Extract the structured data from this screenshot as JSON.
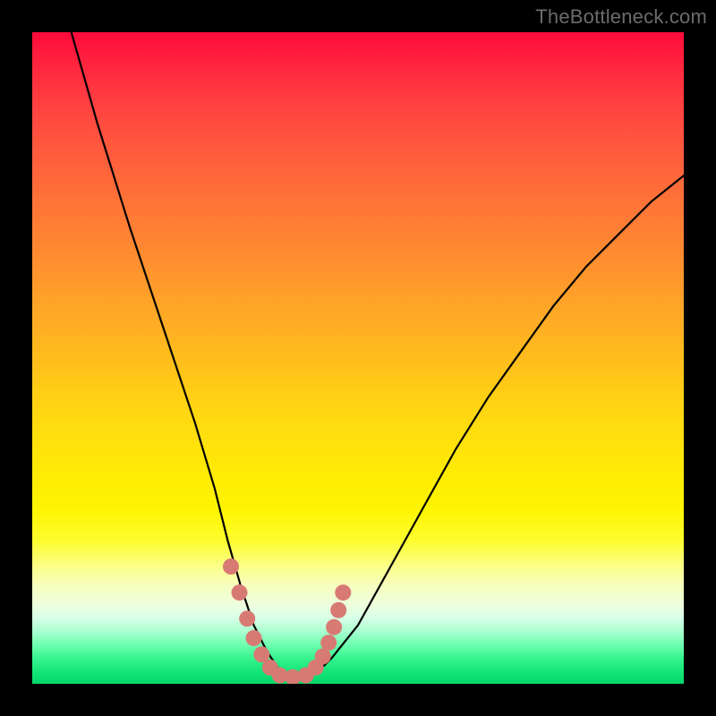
{
  "watermark": {
    "text": "TheBottleneck.com"
  },
  "chart_data": {
    "type": "line",
    "title": "",
    "xlabel": "",
    "ylabel": "",
    "xlim": [
      0,
      100
    ],
    "ylim": [
      0,
      100
    ],
    "grid": false,
    "series": [
      {
        "name": "bottleneck-curve",
        "x": [
          6,
          10,
          15,
          20,
          25,
          28,
          30,
          32,
          34,
          36,
          38,
          40,
          42,
          44,
          46,
          50,
          55,
          60,
          65,
          70,
          75,
          80,
          85,
          90,
          95,
          100
        ],
        "y": [
          100,
          86,
          70,
          55,
          40,
          30,
          22,
          15,
          9,
          5,
          2,
          1,
          1,
          2,
          4,
          9,
          18,
          27,
          36,
          44,
          51,
          58,
          64,
          69,
          74,
          78
        ]
      }
    ],
    "markers": {
      "name": "valley-dots",
      "x": [
        30.5,
        31.8,
        33.0,
        34.0,
        35.2,
        36.5,
        38.0,
        40.0,
        42.0,
        43.5,
        44.6,
        45.5,
        46.3,
        47.0,
        47.7
      ],
      "y": [
        18,
        14,
        10,
        7,
        4.5,
        2.5,
        1.3,
        1,
        1.3,
        2.5,
        4.2,
        6.3,
        8.7,
        11.3,
        14
      ]
    },
    "background_gradient": {
      "top": "#ff0a3a",
      "upper_mid": "#ffa528",
      "mid": "#fff400",
      "lower_mid": "#f6ffbf",
      "bottom": "#04d86a"
    }
  }
}
